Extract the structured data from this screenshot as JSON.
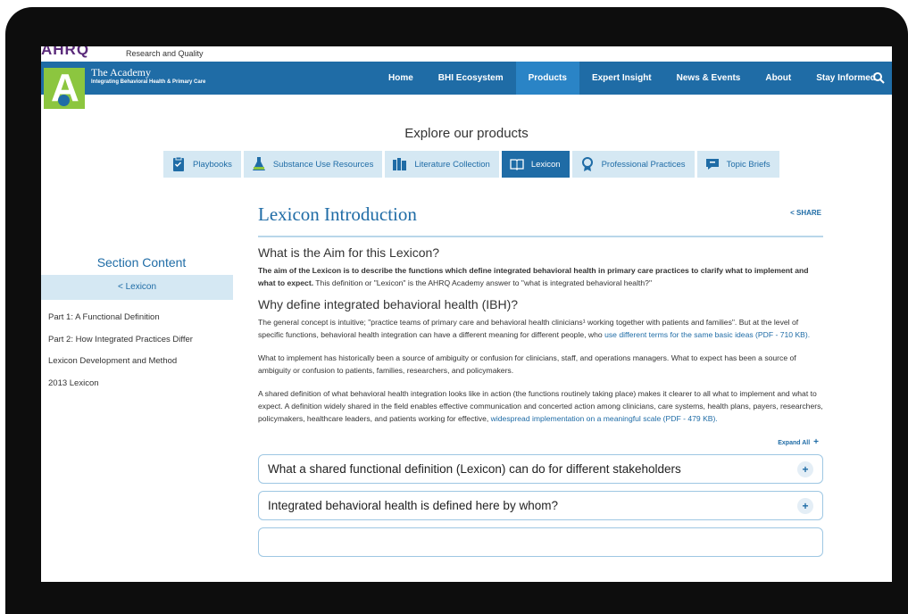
{
  "header": {
    "agency_logo": "AHRQ",
    "agency_text": "Research and Quality",
    "brand_title": "The Academy",
    "brand_subtitle": "Integrating Behavioral Health & Primary Care"
  },
  "nav": {
    "items": [
      {
        "label": "Home",
        "active": false
      },
      {
        "label": "BHI Ecosystem",
        "active": false
      },
      {
        "label": "Products",
        "active": true
      },
      {
        "label": "Expert Insight",
        "active": false
      },
      {
        "label": "News & Events",
        "active": false
      },
      {
        "label": "About",
        "active": false
      },
      {
        "label": "Stay Informed",
        "active": false
      }
    ],
    "search_icon": "search-icon"
  },
  "products": {
    "title": "Explore our products",
    "tabs": [
      {
        "label": "Playbooks",
        "icon": "clipboard-icon",
        "active": false
      },
      {
        "label": "Substance Use Resources",
        "icon": "flask-icon",
        "active": false
      },
      {
        "label": "Literature Collection",
        "icon": "books-icon",
        "active": false
      },
      {
        "label": "Lexicon",
        "icon": "book-icon",
        "active": true
      },
      {
        "label": "Professional Practices",
        "icon": "award-icon",
        "active": false
      },
      {
        "label": "Topic Briefs",
        "icon": "comment-icon",
        "active": false
      }
    ]
  },
  "sidebar": {
    "title": "Section Content",
    "back_link": "< Lexicon",
    "links": [
      "Part 1: A Functional Definition",
      "Part 2: How Integrated Practices Differ",
      "Lexicon Development and Method",
      "2013 Lexicon"
    ]
  },
  "main": {
    "title": "Lexicon Introduction",
    "share": "SHARE",
    "section1": {
      "heading": "What is the Aim for this Lexicon?",
      "bold": "The aim of the Lexicon is to describe the functions which define integrated behavioral health in primary care practices to clarify what to implement and what to expect.",
      "rest": " This definition or \"Lexicon\" is the AHRQ Academy answer to \"what is integrated behavioral health?\""
    },
    "section2": {
      "heading": "Why define integrated behavioral health (IBH)?",
      "p1_text": "The general concept is intuitive; \"practice teams of primary care and behavioral health clinicians¹ working together with patients and families\". But at the level of specific functions, behavioral health integration can have a different meaning for different people, who ",
      "p1_link": "use different terms for the same basic ideas (PDF - 710 KB).",
      "p2": "What to implement has historically been a source of ambiguity or confusion for clinicians, staff, and operations managers. What to expect has been a source of ambiguity or confusion to patients, families, researchers, and policymakers.",
      "p3_text": "A shared definition of what behavioral health integration looks like in action (the functions routinely taking place) makes it clearer to all what to implement and what to expect. A definition widely shared in the field enables effective communication and concerted action among clinicians, care systems, health plans, payers, researchers, policymakers, healthcare leaders, and patients working for effective, ",
      "p3_link": "widespread implementation on a meaningful scale (PDF - 479 KB)."
    },
    "expand_all": "Expand All",
    "accordions": [
      {
        "label": "What a shared functional definition (Lexicon) can do for different stakeholders"
      },
      {
        "label": "Integrated behavioral health is defined here by whom?"
      }
    ]
  }
}
